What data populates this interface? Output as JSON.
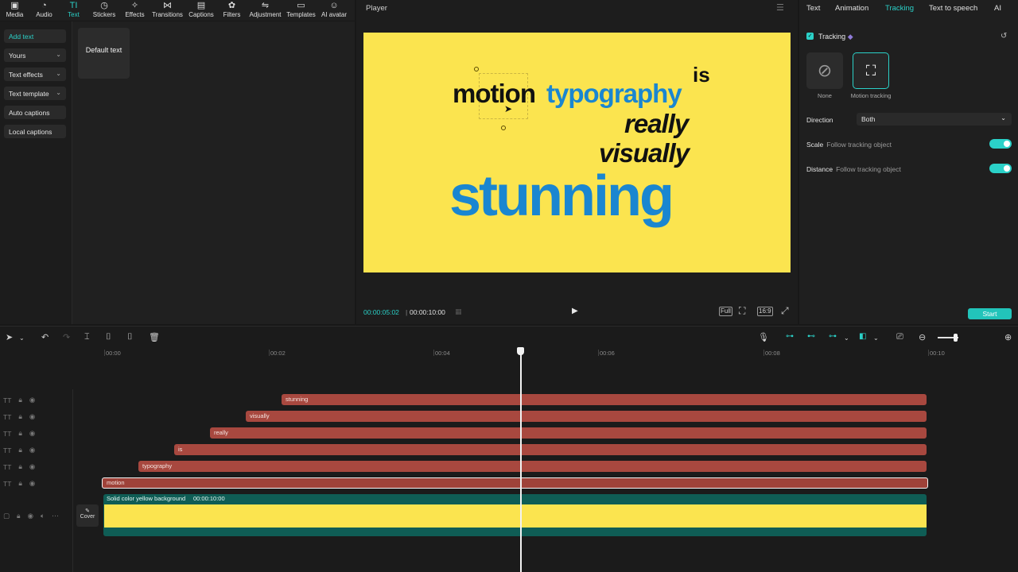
{
  "toolbar": {
    "items": [
      {
        "label": "Media",
        "icon": "media-icon",
        "glyph": "▣"
      },
      {
        "label": "Audio",
        "icon": "audio-icon",
        "glyph": "◔"
      },
      {
        "label": "Text",
        "icon": "text-icon",
        "glyph": "TI"
      },
      {
        "label": "Stickers",
        "icon": "stickers-icon",
        "glyph": "◷"
      },
      {
        "label": "Effects",
        "icon": "effects-icon",
        "glyph": "✧"
      },
      {
        "label": "Transitions",
        "icon": "transitions-icon",
        "glyph": "⋈"
      },
      {
        "label": "Captions",
        "icon": "captions-icon",
        "glyph": "▤"
      },
      {
        "label": "Filters",
        "icon": "filters-icon",
        "glyph": "✿"
      },
      {
        "label": "Adjustment",
        "icon": "adjustment-icon",
        "glyph": "⇋"
      },
      {
        "label": "Templates",
        "icon": "templates-icon",
        "glyph": "▭"
      },
      {
        "label": "AI avatar",
        "icon": "ai-avatar-icon",
        "glyph": "☺"
      }
    ]
  },
  "text_panel": {
    "categories": [
      {
        "label": "Add text"
      },
      {
        "label": "Yours"
      },
      {
        "label": "Text effects"
      },
      {
        "label": "Text template"
      },
      {
        "label": "Auto captions"
      },
      {
        "label": "Local captions"
      }
    ],
    "default_text": "Default text"
  },
  "player": {
    "title": "Player",
    "canvas_words": {
      "motion": "motion",
      "typography": "typography",
      "is": "is",
      "really": "really",
      "visually": "visually",
      "stunning": "stunning"
    },
    "current_time": "00:00:05:02",
    "separator": "|",
    "total_time": "00:00:10:00",
    "controls": {
      "full": "Full",
      "ratio": "16:9"
    }
  },
  "right_panel": {
    "tabs": [
      {
        "label": "Text"
      },
      {
        "label": "Animation"
      },
      {
        "label": "Tracking"
      },
      {
        "label": "Text to speech"
      },
      {
        "label": "AI"
      }
    ],
    "tracking_label": "Tracking",
    "options": [
      {
        "label": "None",
        "icon": "none-icon"
      },
      {
        "label": "Motion tracking",
        "icon": "motion-tracking-icon"
      }
    ],
    "direction_label": "Direction",
    "direction_value": "Both",
    "scale_label": "Scale",
    "scale_sub": "Follow tracking object",
    "distance_label": "Distance",
    "distance_sub": "Follow tracking object",
    "start_label": "Start"
  },
  "timeline": {
    "ticks": [
      "00:00",
      "00:02",
      "00:04",
      "00:06",
      "00:08",
      "00:10"
    ],
    "clips": {
      "stunning": "stunning",
      "visually": "visually",
      "really": "really",
      "is": "is",
      "typography": "typography",
      "motion": "motion"
    },
    "bg_clip_label": "Solid color yellow background",
    "bg_clip_duration": "00:00:10:00",
    "cover_label": "Cover"
  },
  "colors": {
    "accent": "#2bd1c8",
    "canvas_bg": "#fbe44f",
    "text_black": "#111111",
    "text_blue": "#1a86d0",
    "clip_red": "#a8483f",
    "bg_clip_teal": "#0f5d55"
  }
}
